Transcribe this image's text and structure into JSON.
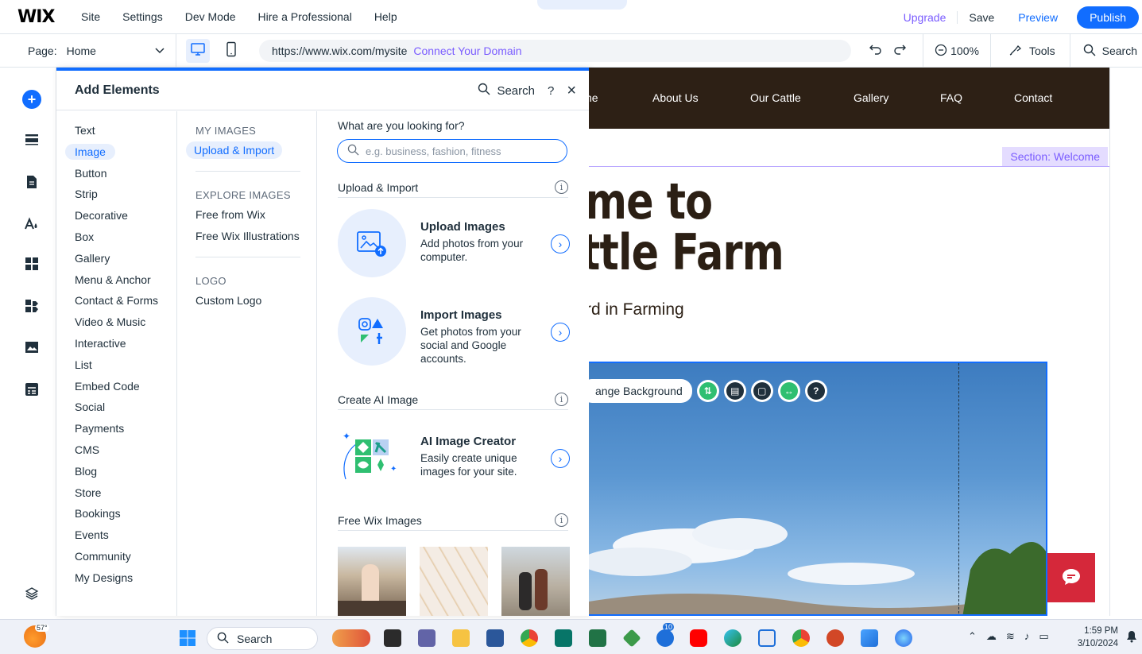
{
  "topbar": {
    "logo": "WIX",
    "menu": [
      "Site",
      "Settings",
      "Dev Mode",
      "Hire a Professional",
      "Help"
    ],
    "upgrade": "Upgrade",
    "save": "Save",
    "preview": "Preview",
    "publish": "Publish"
  },
  "subbar": {
    "page_label": "Page:",
    "page_value": "Home",
    "url": "https://www.wix.com/mysite",
    "connect_domain": "Connect Your Domain",
    "zoom": "100%",
    "tools": "Tools",
    "search": "Search"
  },
  "panel": {
    "title": "Add Elements",
    "search": "Search",
    "help": "?",
    "close": "×",
    "categories": [
      "Text",
      "Image",
      "Button",
      "Strip",
      "Decorative",
      "Box",
      "Gallery",
      "Menu & Anchor",
      "Contact & Forms",
      "Video & Music",
      "Interactive",
      "List",
      "Embed Code",
      "Social",
      "Payments",
      "CMS",
      "Blog",
      "Store",
      "Bookings",
      "Events",
      "Community",
      "My Designs"
    ],
    "selected_category": "Image",
    "sub": {
      "my_images": "MY IMAGES",
      "upload_import": "Upload & Import",
      "explore_images": "EXPLORE IMAGES",
      "free_from_wix": "Free from Wix",
      "free_illustrations": "Free Wix Illustrations",
      "logo": "LOGO",
      "custom_logo": "Custom Logo"
    },
    "content": {
      "question": "What are you looking for?",
      "search_placeholder": "e.g. business, fashion, fitness",
      "section_upload": "Upload & Import",
      "upload_title": "Upload Images",
      "upload_desc": "Add photos from your computer.",
      "import_title": "Import Images",
      "import_desc": "Get photos from your social and Google accounts.",
      "section_ai": "Create AI Image",
      "ai_title": "AI Image Creator",
      "ai_desc": "Easily create unique images for your site.",
      "section_free": "Free Wix Images"
    }
  },
  "site": {
    "nav": [
      "ne",
      "About Us",
      "Our Cattle",
      "Gallery",
      "FAQ",
      "Contact"
    ],
    "section_badge": "Section: Welcome",
    "hero_line1": "me to",
    "hero_line2": "ttle Farm",
    "hero_sub": "rd in Farming",
    "change_background": "ange Background"
  },
  "taskbar": {
    "temperature": "57°",
    "search": "Search",
    "time": "1:59 PM",
    "date": "3/10/2024",
    "badge_count": "10"
  },
  "colors": {
    "accent": "#116dff",
    "premium": "#7a5cff",
    "site_nav_bg": "#2d2015",
    "chat_red": "#d5283a"
  }
}
